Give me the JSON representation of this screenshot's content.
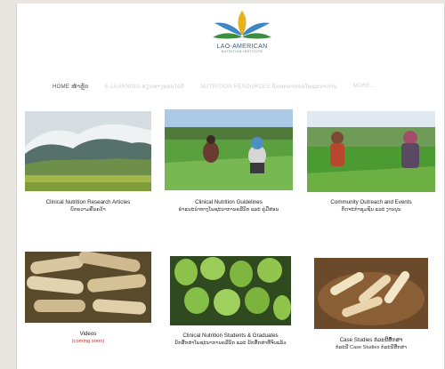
{
  "logo": {
    "title": "LAO-AMERICAN",
    "subtitle": "NUTRITION INSTITUTE",
    "colors": {
      "yellow": "#e5b11f",
      "blue": "#3f86c4",
      "green": "#3b8e3f"
    }
  },
  "nav": {
    "items": [
      {
        "label": "HOME ໜ້າຫຼັກ"
      },
      {
        "label": "E-LEARNING ຮຽນທາງອອນໄລນ໌"
      },
      {
        "label": "NUTRITION RESOURCES ຊັບພະຍາກອນໂພຊະນາການ"
      },
      {
        "label": "MORE..."
      }
    ]
  },
  "cards": [
    {
      "title": "Clinical Nutrition Research Articles",
      "subtitle": "ບົດຄວາມຄົ້ນຄວ້າ",
      "image": "misty-mountains-rice-fields"
    },
    {
      "title": "Clinical Nutrition Guidelines",
      "subtitle": "ຄຳແນະນຳທາງໂພຊະນາການຄລີນິກ ແລະ ຄູ່ມືສອນ",
      "image": "women-working-rice-paddy"
    },
    {
      "title": "Community Outreach and Events",
      "subtitle": "ກິດຈະກຳຊຸມຊົນ ແລະ ງານບຸນ",
      "image": "elders-in-garden"
    },
    {
      "title": "Videos",
      "subtitle": "(coming soon)",
      "image": "bamboo-shoots"
    },
    {
      "title": "Clinical Nutrition Students & Graduates",
      "subtitle": "ນັກສຶກສາໂພຊະນາການຄລີນິກ ແລະ ນັກສຶກສາທີ່ຈົບແລ້ວ",
      "image": "green-fruits"
    },
    {
      "title": "Case Studies ກໍລະນີສຶກສາ",
      "subtitle": "ກໍລະນີ Case Studies ກໍລະນີສຶກສາ",
      "image": "bamboo-basket"
    }
  ]
}
